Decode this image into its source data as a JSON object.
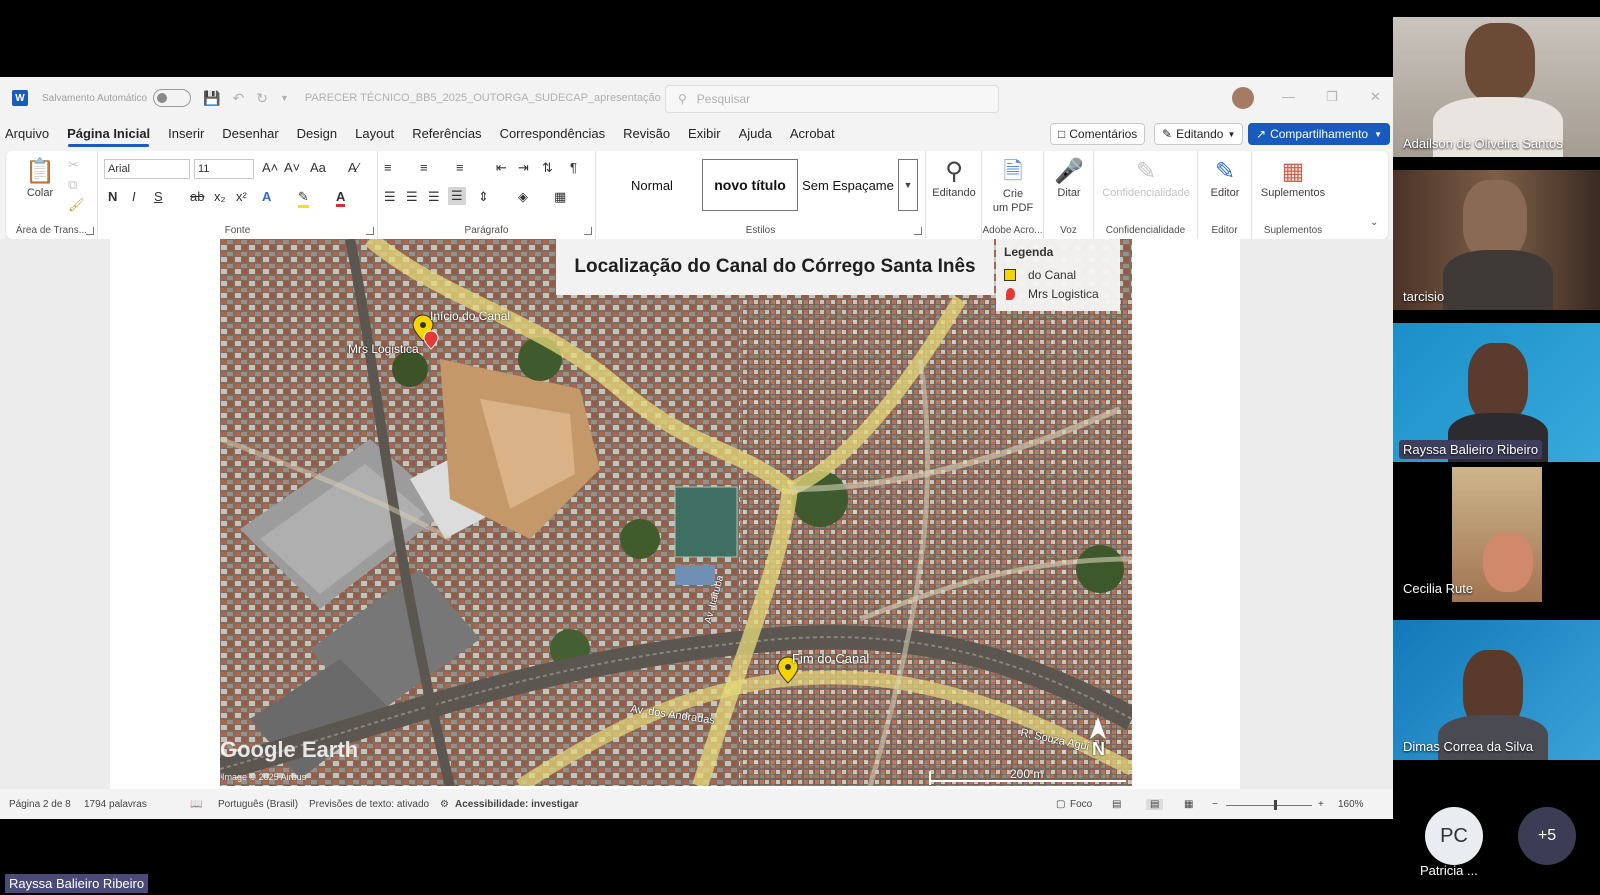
{
  "word": {
    "autosave_label": "Salvamento Automático",
    "doc_name": "PARECER TÉCNICO_BB5_2025_OUTORGA_SUDECAP_apresentação",
    "search_placeholder": "Pesquisar",
    "menu": [
      "Arquivo",
      "Página Inicial",
      "Inserir",
      "Desenhar",
      "Design",
      "Layout",
      "Referências",
      "Correspondências",
      "Revisão",
      "Exibir",
      "Ajuda",
      "Acrobat"
    ],
    "comments_label": "Comentários",
    "editing_label": "Editando",
    "share_label": "Compartilhamento",
    "ribbon": {
      "paste_label": "Colar",
      "clipboard_label": "Área de Trans...",
      "font_name": "Arial",
      "font_size": "11",
      "font_group": "Fonte",
      "bold": "N",
      "italic": "I",
      "underline": "S",
      "paragraph_group": "Parágrafo",
      "styles": [
        "Normal",
        "novo título",
        "Sem Espaçame"
      ],
      "styles_group": "Estilos",
      "editing_btn": "Editando",
      "pdf_btn_1": "Crie",
      "pdf_btn_2": "um PDF",
      "adobe_group": "Adobe Acro...",
      "dictate_btn": "Ditar",
      "voice_group": "Voz",
      "confidentiality_btn": "Confidencialidade",
      "confidentiality_group": "Confidencialidade",
      "editor_btn": "Editor",
      "editor_group": "Editor",
      "addins_btn": "Suplementos",
      "addins_group": "Suplementos"
    },
    "map": {
      "title": "Localização do Canal do Córrego Santa Inês",
      "legend_title": "Legenda",
      "legend_items": [
        "do Canal",
        "Mrs Logistica"
      ],
      "pin_start": "Início do Canal",
      "pin_mrs": "Mrs Logistica",
      "pin_end": "Fim do Canal",
      "road_1": "Av. Itaituba",
      "road_2": "Av. dos Andradas",
      "road_3": "R. Souza Agui",
      "scale": "200 m",
      "north": "N",
      "watermark": "Google Earth",
      "credit": "Image © 2025 Airbus"
    },
    "status": {
      "page": "Página 2 de 8",
      "words": "1794 palavras",
      "language": "Português (Brasil)",
      "text_pred": "Previsões de texto: ativado",
      "accessibility": "Acessibilidade: investigar",
      "focus": "Foco",
      "zoom": "160%"
    }
  },
  "participants": [
    {
      "name": "Adailson de Oliveira Santos"
    },
    {
      "name": "tarcisio"
    },
    {
      "name": "Rayssa Balieiro Ribeiro"
    },
    {
      "name": "Cecilia Rute"
    },
    {
      "name": "Dimas Correa da Silva"
    }
  ],
  "bottom": {
    "pc_initials": "PC",
    "pc_name": "Patricia ...",
    "more": "+5",
    "presenter": "Rayssa Balieiro Ribeiro"
  }
}
